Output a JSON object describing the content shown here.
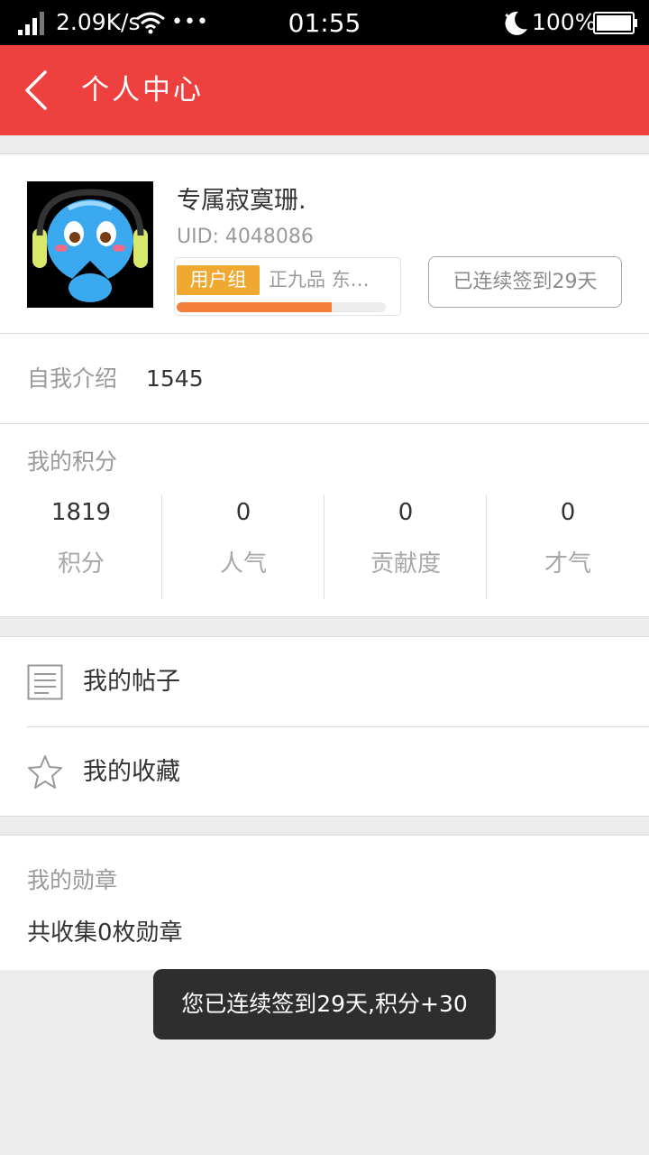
{
  "status_bar": {
    "network_speed": "2.09K/s",
    "more": "•••",
    "time": "01:55",
    "battery": "100%"
  },
  "header": {
    "title": "个人中心",
    "back_icon": "chevron-left-icon"
  },
  "profile": {
    "username": "专属寂寞珊.",
    "uid": "UID: 4048086",
    "group_tag": "用户组",
    "group_name": "正九品 东…",
    "level_progress_fraction": 0.74,
    "signin_label": "已连续签到29天",
    "avatar_icon": "cartoon-headphones-avatar"
  },
  "intro": {
    "label": "自我介绍",
    "value": "1545"
  },
  "points": {
    "title": "我的积分",
    "stats": [
      {
        "value": "1819",
        "label": "积分"
      },
      {
        "value": "0",
        "label": "人气"
      },
      {
        "value": "0",
        "label": "贡献度"
      },
      {
        "value": "0",
        "label": "才气"
      }
    ]
  },
  "menu": {
    "items": [
      {
        "label": "我的帖子",
        "icon": "document-icon"
      },
      {
        "label": "我的收藏",
        "icon": "star-icon"
      }
    ]
  },
  "medals": {
    "title": "我的勋章",
    "count_text": "共收集0枚勋章"
  },
  "toast": {
    "message": "您已连续签到29天,积分+30"
  },
  "colors": {
    "header": "#ef4040",
    "group_tag": "#f0a830",
    "progress": "#f47f3a"
  }
}
